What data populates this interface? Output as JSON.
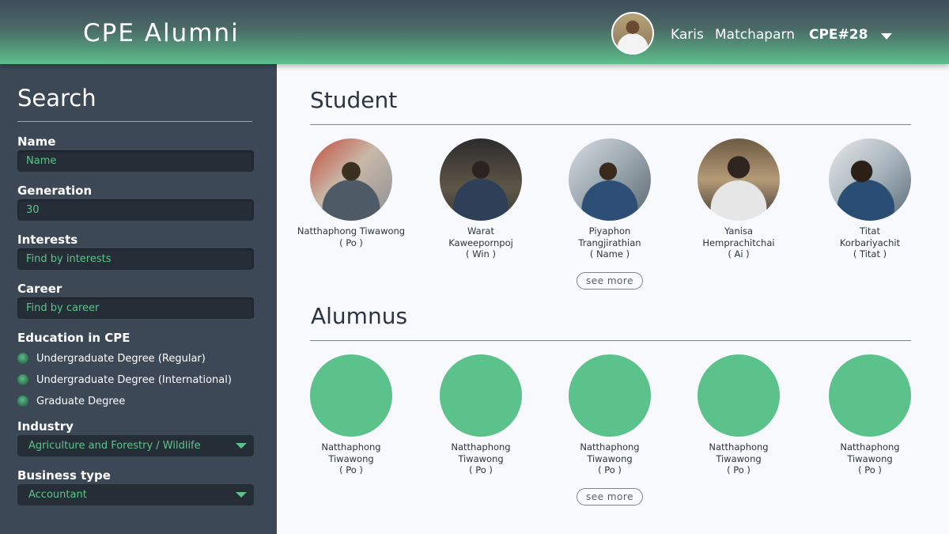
{
  "header": {
    "app_title": "CPE Alumni",
    "user": {
      "first_name": "Karis",
      "last_name": "Matchaparn",
      "generation": "CPE#28"
    }
  },
  "sidebar": {
    "heading": "Search",
    "name": {
      "label": "Name",
      "placeholder": "Name"
    },
    "generation": {
      "label": "Generation",
      "value": "30"
    },
    "interests": {
      "label": "Interests",
      "placeholder": "Find by interests"
    },
    "career": {
      "label": "Career",
      "placeholder": "Find by career"
    },
    "education": {
      "label": "Education in CPE",
      "options": [
        "Undergraduate Degree (Regular)",
        "Undergraduate Degree (International)",
        "Graduate Degree"
      ]
    },
    "industry": {
      "label": "Industry",
      "selected": "Agriculture and Forestry / Wildlife"
    },
    "business_type": {
      "label": "Business type",
      "selected": "Accountant"
    }
  },
  "students": {
    "title": "Student",
    "see_more": "see more",
    "people": [
      {
        "name_line1": "Natthaphong Tiwawong",
        "name_line2": "",
        "nick": "( Po )"
      },
      {
        "name_line1": "Warat",
        "name_line2": "Kaweepornpoj",
        "nick": "( Win )"
      },
      {
        "name_line1": "Piyaphon",
        "name_line2": "Trangjirathian",
        "nick": "( Name )"
      },
      {
        "name_line1": "Yanisa",
        "name_line2": "Hemprachitchai",
        "nick": "( Ai )"
      },
      {
        "name_line1": "Titat",
        "name_line2": "Korbariyachit",
        "nick": "( Titat )"
      }
    ]
  },
  "alumni": {
    "title": "Alumnus",
    "see_more": "see more",
    "people": [
      {
        "name_line1": "Natthaphong",
        "name_line2": "Tiwawong",
        "nick": "( Po )"
      },
      {
        "name_line1": "Natthaphong",
        "name_line2": "Tiwawong",
        "nick": "( Po )"
      },
      {
        "name_line1": "Natthaphong",
        "name_line2": "Tiwawong",
        "nick": "( Po )"
      },
      {
        "name_line1": "Natthaphong",
        "name_line2": "Tiwawong",
        "nick": "( Po )"
      },
      {
        "name_line1": "Natthaphong",
        "name_line2": "Tiwawong",
        "nick": "( Po )"
      }
    ]
  },
  "colors": {
    "accent_green": "#5cc28b",
    "sidebar_bg": "#3c4856",
    "input_bg": "#252d36"
  }
}
